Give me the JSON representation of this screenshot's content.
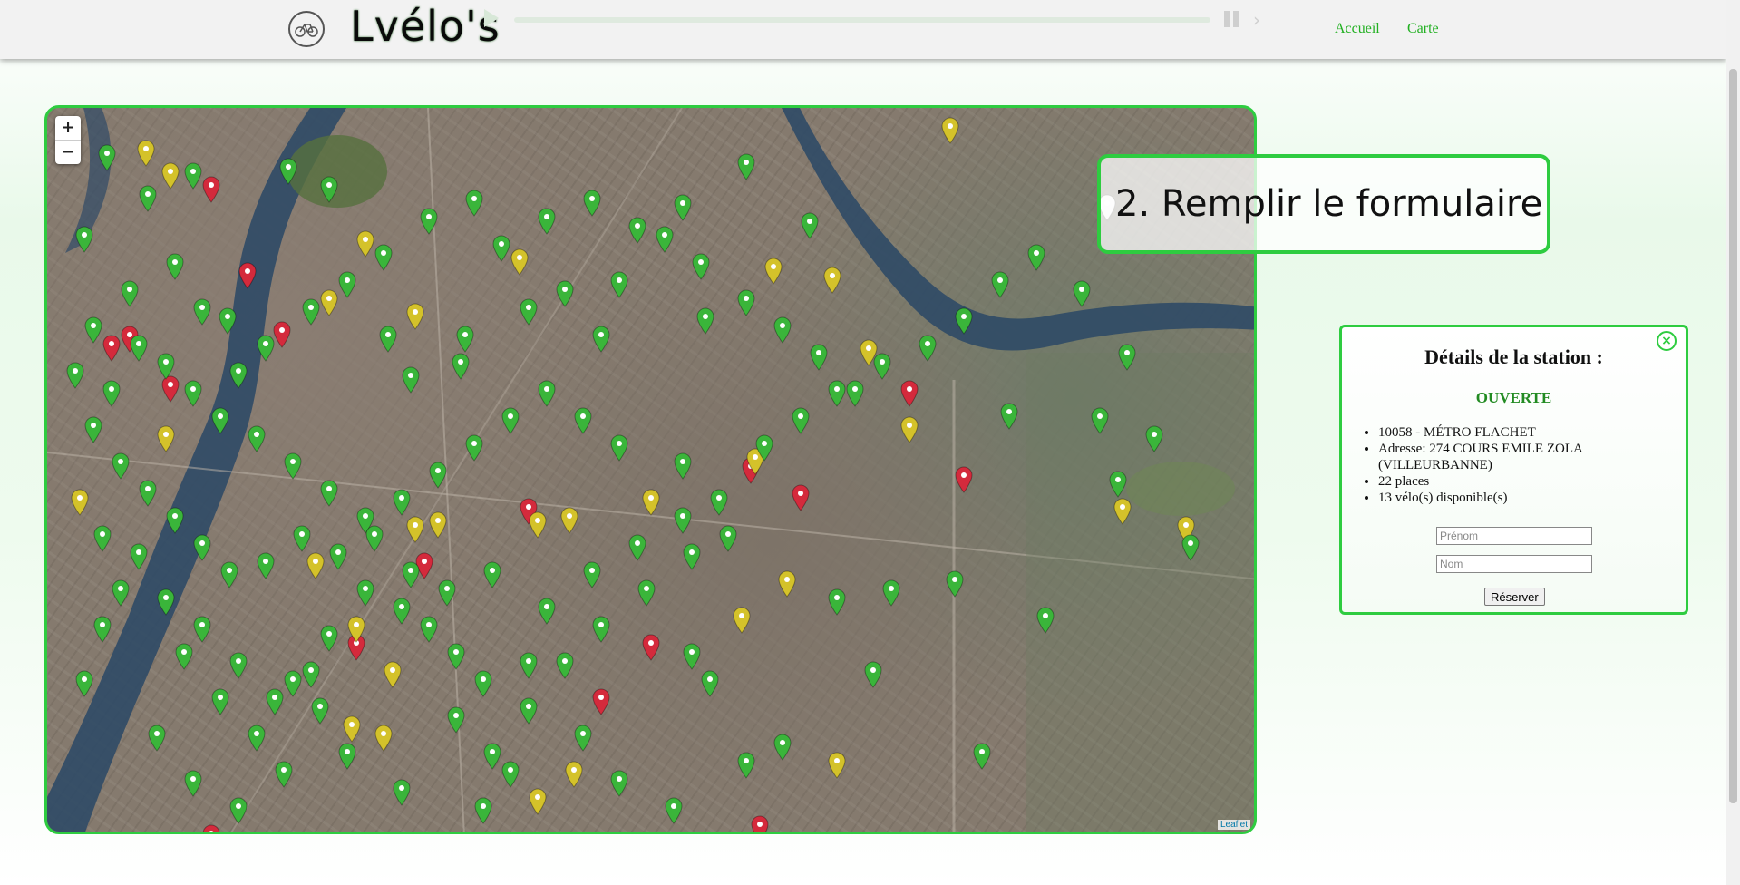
{
  "header": {
    "brand": "Lvélo's",
    "nav": [
      {
        "label": "Accueil"
      },
      {
        "label": "Carte"
      }
    ]
  },
  "map": {
    "zoom_in": "+",
    "zoom_out": "−",
    "attribution": "Leaflet",
    "marker_colors": {
      "green": "#3ab53a",
      "yellow": "#d4c22a",
      "red": "#d42a3c",
      "white": "#f5f5f5"
    }
  },
  "callout": {
    "text": "2. Remplir le formulaire"
  },
  "panel": {
    "title": "Détails de la station :",
    "status": "OUVERTE",
    "details": [
      "10058 - MÉTRO FLACHET",
      "Adresse: 274 COURS EMILE ZOLA (VILLEURBANNE)",
      "22 places",
      "13 vélo(s) disponible(s)"
    ],
    "firstname_placeholder": "Prénom",
    "lastname_placeholder": "Nom",
    "reserve_label": "Réserver",
    "close_icon": "×"
  }
}
